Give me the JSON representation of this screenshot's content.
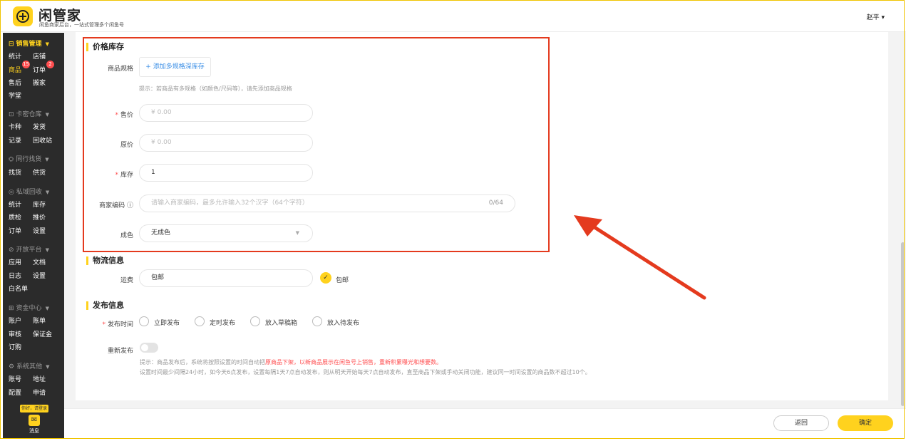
{
  "brand": {
    "name": "闲管家",
    "subtitle": "闲鱼商家后台，一站式管理多个闲鱼号"
  },
  "user": {
    "name": "赵平 ▾"
  },
  "sidebar": {
    "sections": [
      {
        "title": "销售管理",
        "icon": "bag-icon",
        "items": [
          "统计",
          "店铺",
          "商品",
          "订单",
          "售后",
          "搬家",
          "学堂"
        ]
      },
      {
        "title": "卡密仓库",
        "icon": "box-icon",
        "items": [
          "卡种",
          "发货",
          "记录",
          "回收站"
        ]
      },
      {
        "title": "同行找货",
        "icon": "people-icon",
        "items": [
          "找货",
          "供货"
        ]
      },
      {
        "title": "私域回收",
        "icon": "recycle-icon",
        "items": [
          "统计",
          "库存",
          "质检",
          "推价",
          "订单",
          "设置"
        ]
      },
      {
        "title": "开放平台",
        "icon": "shield-icon",
        "items": [
          "应用",
          "文档",
          "日志",
          "设置",
          "白名单"
        ]
      },
      {
        "title": "资金中心",
        "icon": "wallet-icon",
        "items": [
          "账户",
          "账单",
          "审核",
          "保证金",
          "订购"
        ]
      },
      {
        "title": "系统其他",
        "icon": "gear-icon",
        "items": [
          "账号",
          "地址",
          "配置",
          "申请"
        ]
      }
    ],
    "badges": {
      "goods": "15",
      "orders": "2"
    },
    "login_tag": "你好，请登录",
    "message_label": "消息"
  },
  "price_section": {
    "title": "价格库存",
    "spec_label": "商品规格",
    "spec_button": "+ 添加多规格深库存",
    "spec_hint": "提示：若商品有多规格（如颜色/尺码等），请先添加商品规格",
    "price_label": "售价",
    "price_placeholder": "¥ 0.00",
    "orig_label": "原价",
    "orig_placeholder": "¥ 0.00",
    "stock_label": "库存",
    "stock_value": "1",
    "code_label": "商家编码 ⓘ",
    "code_placeholder": "请输入商家编码，最多允许输入32个汉字（64个字符）",
    "code_count": "0/64",
    "condition_label": "成色",
    "condition_value": "无成色"
  },
  "logistics": {
    "title": "物流信息",
    "freight_label": "运费",
    "freight_value": "包邮",
    "free_shipping": "包邮"
  },
  "publish": {
    "title": "发布信息",
    "time_label": "发布时间",
    "options": [
      "立即发布",
      "定时发布",
      "放入草稿箱",
      "放入待发布"
    ],
    "republish_label": "重新发布",
    "hint_prefix": "提示：商品发布后，系统将按照设置的时间自动把",
    "hint_red": "原商品下架，以新商品展示在闲鱼号上销售，重新积累曝光和想要数。",
    "hint_line2": "设置时间最少间隔24小时，如今天6点发布，设置每隔1天7点自动发布，则从明天开始每天7点自动发布，直至商品下架或手动关闭功能，建议同一时间设置的商品数不超过10个。"
  },
  "footer": {
    "back": "返回",
    "confirm": "确定"
  },
  "colors": {
    "accent": "#ffd21e",
    "highlight": "#e43a1e",
    "link": "#3a8ee6"
  }
}
